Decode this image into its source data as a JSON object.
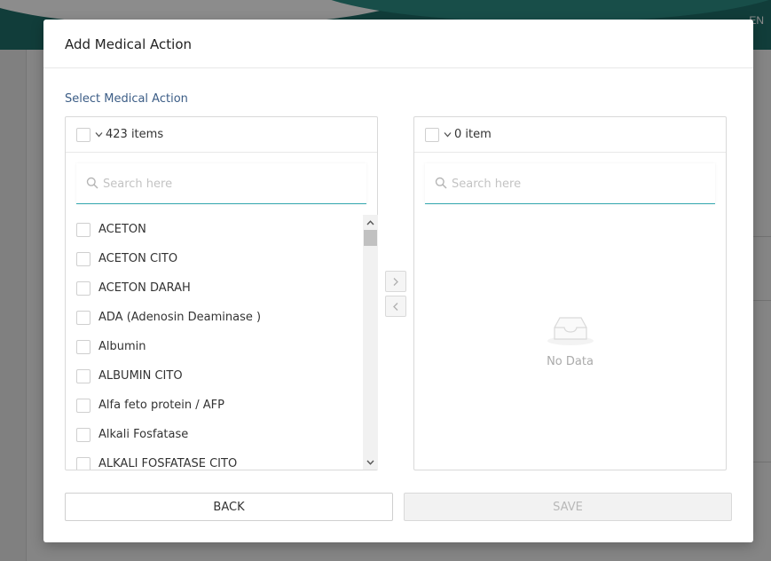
{
  "background": {
    "lang": "EN"
  },
  "modal": {
    "title": "Add Medical Action",
    "section_label": "Select Medical Action"
  },
  "left_panel": {
    "count_label": "423 items",
    "search_placeholder": "Search here",
    "items": [
      "ACETON",
      "ACETON CITO",
      "ACETON DARAH",
      "ADA (Adenosin Deaminase )",
      "Albumin",
      "ALBUMIN CITO",
      "Alfa feto protein / AFP",
      "Alkali Fosfatase",
      "ALKALI FOSFATASE CITO"
    ]
  },
  "right_panel": {
    "count_label": "0 item",
    "search_placeholder": "Search here",
    "empty_text": "No Data"
  },
  "transfer": {
    "move_right_icon": "chevron-right-icon",
    "move_left_icon": "chevron-left-icon"
  },
  "footer": {
    "back_label": "BACK",
    "save_label": "SAVE"
  },
  "colors": {
    "accent": "#36a8b0",
    "section_label": "#3c5d86",
    "header_bg": "#1f6f6a"
  }
}
